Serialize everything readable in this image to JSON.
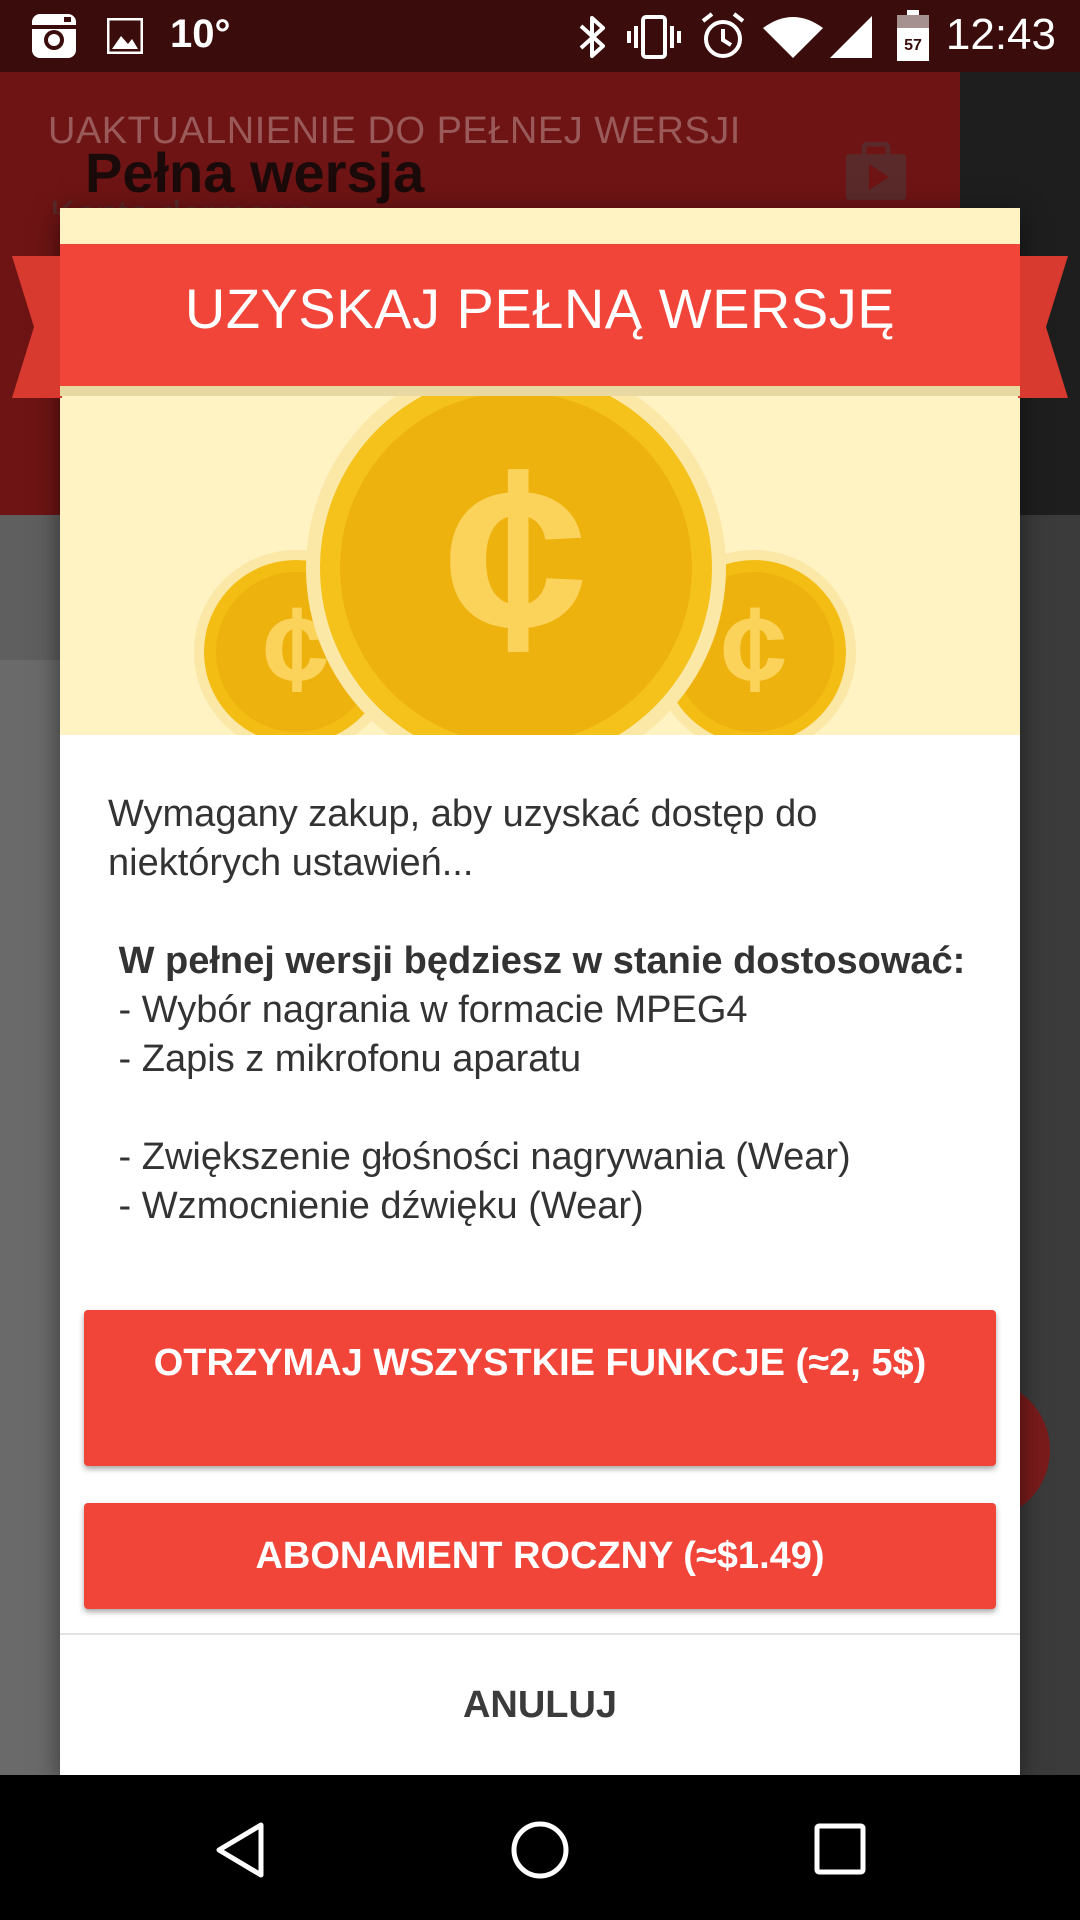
{
  "status_bar": {
    "temperature": "10°",
    "time": "12:43",
    "battery_level": "57",
    "icons": [
      "instagram-icon",
      "image-icon",
      "bluetooth-icon",
      "vibrate-icon",
      "alarm-icon",
      "wifi-icon",
      "signal-icon",
      "battery-icon"
    ]
  },
  "background": {
    "upgrade_label": "UAKTUALNIENIE DO PEŁNEJ WERSJI",
    "title": "Pełna wersja",
    "subtitle": "Konto darmowe"
  },
  "dialog": {
    "title": "UZYSKAJ PEŁNĄ WERSJĘ",
    "message_intro": "Wymagany zakup, aby uzyskać dostęp do niektórych ustawień...",
    "features_heading": " W pełnej wersji będziesz w stanie dostosować:",
    "features": [
      " - Wybór nagrania w formacie MPEG4",
      " - Zapis z mikrofonu aparatu",
      "",
      " - Zwiększenie głośności nagrywania (Wear)",
      " - Wzmocnienie dźwięku (Wear)"
    ],
    "buttons": {
      "buy_all": "OTRZYMAJ WSZYSTKIE FUNKCJE (≈2, 5$)",
      "subscription": "ABONAMENT ROCZNY (≈$1.49)",
      "cancel": "ANULUJ"
    },
    "colors": {
      "accent": "#f2453a",
      "hero_background": "#fff3c4",
      "coin": "#f5c21b"
    }
  },
  "nav_bar": {
    "icons": [
      "back-icon",
      "home-icon",
      "recents-icon"
    ]
  }
}
